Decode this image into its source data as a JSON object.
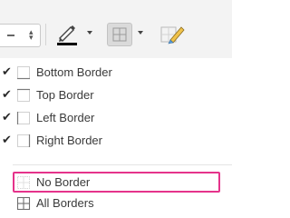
{
  "toolbar": {
    "line_style_icon": "line-dash-icon",
    "pen_icon": "pen-color-icon",
    "pen_underline_color": "#000000",
    "borders_icon": "borders-grid-icon",
    "eraser_icon": "eraser-icon"
  },
  "menu": {
    "items": [
      {
        "label": "Bottom Border",
        "checked": true,
        "icon": "border-bottom-icon"
      },
      {
        "label": "Top Border",
        "checked": true,
        "icon": "border-top-icon"
      },
      {
        "label": "Left Border",
        "checked": true,
        "icon": "border-left-icon"
      },
      {
        "label": "Right Border",
        "checked": true,
        "icon": "border-right-icon"
      },
      {
        "label": "No Border",
        "checked": false,
        "icon": "border-none-icon",
        "highlighted": true
      },
      {
        "label": "All Borders",
        "checked": false,
        "icon": "border-all-icon"
      }
    ],
    "check_glyph": "✔",
    "highlight_color": "#e5338b"
  }
}
